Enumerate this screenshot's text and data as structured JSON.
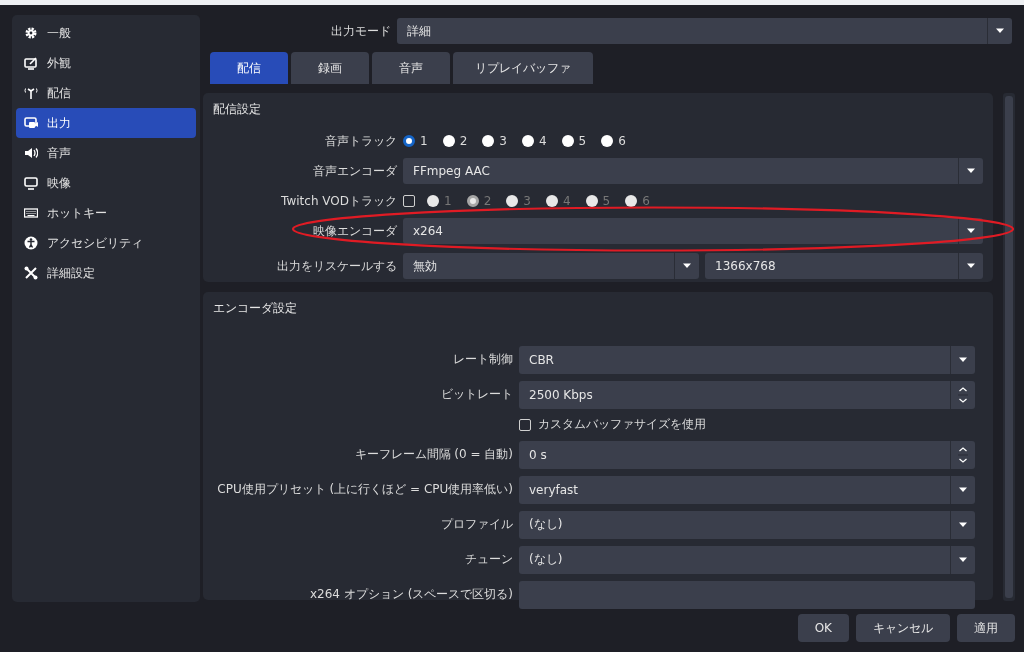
{
  "sidebar": {
    "items": [
      {
        "label": "一般",
        "selected": false
      },
      {
        "label": "外観",
        "selected": false
      },
      {
        "label": "配信",
        "selected": false
      },
      {
        "label": "出力",
        "selected": true
      },
      {
        "label": "音声",
        "selected": false
      },
      {
        "label": "映像",
        "selected": false
      },
      {
        "label": "ホットキー",
        "selected": false
      },
      {
        "label": "アクセシビリティ",
        "selected": false
      },
      {
        "label": "詳細設定",
        "selected": false
      }
    ]
  },
  "output_mode": {
    "label": "出力モード",
    "value": "詳細"
  },
  "tabs": [
    {
      "label": "配信",
      "selected": true
    },
    {
      "label": "録画",
      "selected": false
    },
    {
      "label": "音声",
      "selected": false
    },
    {
      "label": "リプレイバッファ",
      "selected": false
    }
  ],
  "stream_settings": {
    "title": "配信設定",
    "rows": [
      {
        "kind": "radios",
        "label": "音声トラック",
        "disabled": false,
        "options": [
          {
            "label": "1",
            "selected": true
          },
          {
            "label": "2",
            "selected": false
          },
          {
            "label": "3",
            "selected": false
          },
          {
            "label": "4",
            "selected": false
          },
          {
            "label": "5",
            "selected": false
          },
          {
            "label": "6",
            "selected": false
          }
        ]
      },
      {
        "kind": "select",
        "label": "音声エンコーダ",
        "value": "FFmpeg AAC",
        "highlighted": false
      },
      {
        "kind": "check-radios",
        "label": "Twitch VODトラック",
        "checked": false,
        "disabled": true,
        "options": [
          {
            "label": "1",
            "selected": false
          },
          {
            "label": "2",
            "selected": true
          },
          {
            "label": "3",
            "selected": false
          },
          {
            "label": "4",
            "selected": false
          },
          {
            "label": "5",
            "selected": false
          },
          {
            "label": "6",
            "selected": false
          }
        ]
      },
      {
        "kind": "select",
        "label": "映像エンコーダ",
        "value": "x264",
        "highlighted": true
      },
      {
        "kind": "double-select",
        "label": "出力をリスケールする",
        "values": [
          "無効",
          "1366x768"
        ]
      }
    ]
  },
  "encoder_settings": {
    "title": "エンコーダ設定",
    "rows": [
      {
        "kind": "select",
        "label": "レート制御",
        "value": "CBR"
      },
      {
        "kind": "spin",
        "label": "ビットレート",
        "value": "2500 Kbps"
      },
      {
        "kind": "checkbox",
        "label": "カスタムバッファサイズを使用",
        "checked": false
      },
      {
        "kind": "spin",
        "label": "キーフレーム間隔 (0 = 自動)",
        "value": "0 s"
      },
      {
        "kind": "select",
        "label": "CPU使用プリセット (上に行くほど = CPU使用率低い)",
        "value": "veryfast"
      },
      {
        "kind": "select",
        "label": "プロファイル",
        "value": "(なし)"
      },
      {
        "kind": "select",
        "label": "チューン",
        "value": "(なし)"
      },
      {
        "kind": "text",
        "label": "x264 オプション (スペースで区切る)"
      }
    ]
  },
  "buttons": [
    {
      "label": "OK"
    },
    {
      "label": "キャンセル"
    },
    {
      "label": "適用"
    }
  ]
}
